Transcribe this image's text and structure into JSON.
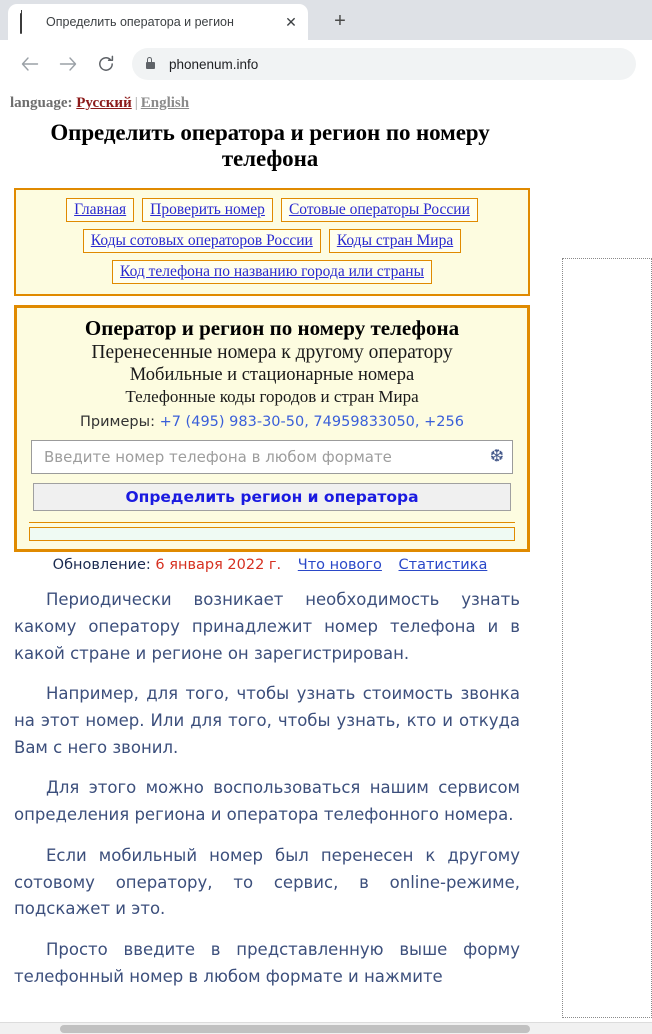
{
  "browser": {
    "tab": {
      "favicon": "mobile-phone-icon",
      "title": "Определить оператора и регион",
      "close_label": "✕"
    },
    "new_tab_label": "+",
    "nav": {
      "back": "←",
      "forward": "→",
      "reload": "⟳"
    },
    "omnibox": {
      "lock": "lock-icon",
      "url": "phonenum.info"
    }
  },
  "page": {
    "language_bar": {
      "label": "language:",
      "ru": "Русский",
      "separator": "|",
      "en": "English"
    },
    "title": "Определить оператора и регион по номеру телефона",
    "nav_panel": {
      "rows": [
        [
          "Главная",
          "Проверить номер",
          "Сотовые операторы России"
        ],
        [
          "Коды сотовых операторов России",
          "Коды стран Мира"
        ],
        [
          "Код телефона по названию города или страны"
        ]
      ]
    },
    "form_box": {
      "heading1": "Оператор и регион по номеру телефона",
      "heading2": "Перенесенные номера к другому оператору",
      "heading3": "Мобильные и стационарные номера",
      "heading4": "Телефонные коды городов и стран Мира",
      "examples_label": "Примеры:",
      "examples_values": "+7 (495) 983-30-50, 74959833050, +256",
      "input_placeholder": "Введите номер телефона в любом формате",
      "input_value": "",
      "snowflake_icon": "❆",
      "submit_label": "Определить регион и оператора",
      "result_text": ""
    },
    "update_line": {
      "label": "Обновление:",
      "date": "6 января 2022 г.",
      "links": [
        "Что нового",
        "Статистика"
      ]
    },
    "article": {
      "paragraphs": [
        "Периодически возникает необходимость узнать какому оператору принадлежит номер телефона и в какой стране и регионе он зарегистрирован.",
        "Например, для того, чтобы узнать стоимость звонка на этот номер. Или для того, чтобы узнать, кто и откуда Вам с него звонил.",
        "Для этого можно воспользоваться нашим сервисом определения региона и оператора телефонного номера.",
        "Если мобильный номер был перенесен к другому сотовому оператору, то сервис, в online-режиме, подскажет и это.",
        "Просто введите в представленную выше форму телефонный номер в любом формате и нажмите"
      ]
    }
  },
  "colors": {
    "accent_orange": "#e08a00",
    "panel_yellow": "#fdfce0",
    "link_blue": "#2a2ad0",
    "body_text": "#3c4f7c",
    "date_red": "#d63020"
  }
}
